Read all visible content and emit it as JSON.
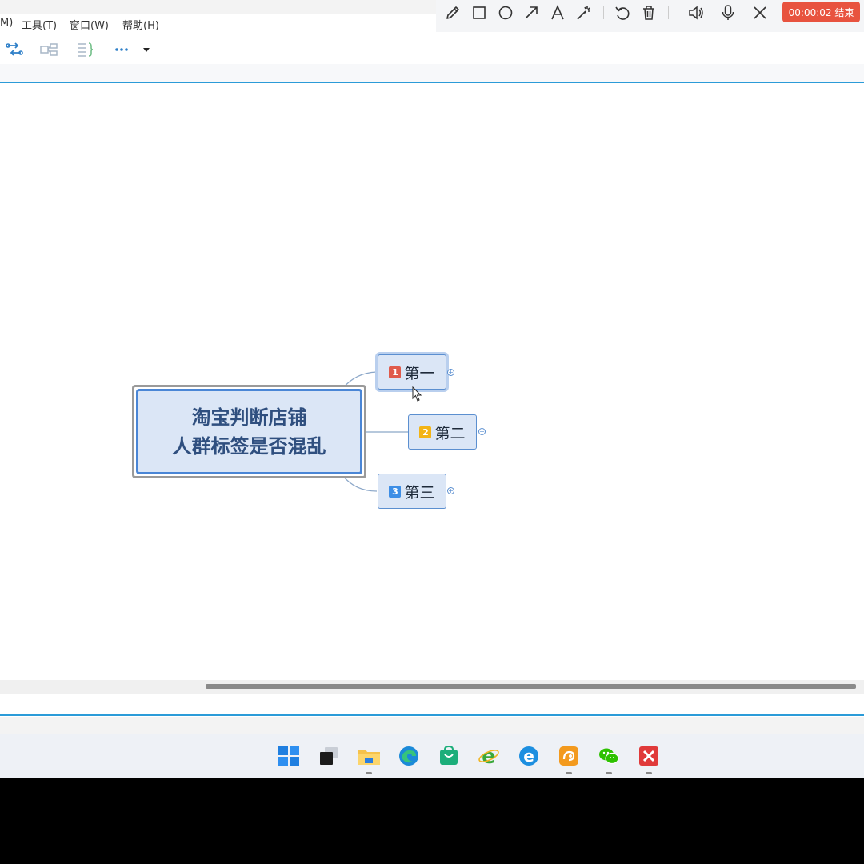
{
  "menu": {
    "items": [
      {
        "label": "M)"
      },
      {
        "label": "工具(T)"
      },
      {
        "label": "窗口(W)"
      },
      {
        "label": "帮助(H)"
      }
    ]
  },
  "recorder": {
    "tools": [
      "pencil-icon",
      "rectangle-icon",
      "ellipse-icon",
      "arrow-icon",
      "text-icon",
      "magic-wand-icon",
      "undo-icon",
      "delete-icon",
      "speaker-icon",
      "microphone-icon",
      "close-icon"
    ],
    "timer_label": "00:00:02 结束",
    "timer_color": "#e8533f"
  },
  "toolbar": {
    "icons": [
      "relationship-icon",
      "summary-icon",
      "boundary-icon",
      "more-icon",
      "dropdown-arrow-icon"
    ],
    "more_label": "···"
  },
  "mindmap": {
    "central": {
      "line1": "淘宝判断店铺",
      "line2": "人群标签是否混乱"
    },
    "topics": [
      {
        "badge": "1",
        "label": "第一",
        "badge_color": "#e05b4c",
        "selected": true
      },
      {
        "badge": "2",
        "label": "第二",
        "badge_color": "#f3b416",
        "selected": false
      },
      {
        "badge": "3",
        "label": "第三",
        "badge_color": "#3d8ee6",
        "selected": false
      }
    ],
    "accent": "#4a86d6",
    "fill": "#dbe6f6"
  },
  "taskbar": {
    "apps": [
      "windows-start-icon",
      "task-view-icon",
      "file-explorer-icon",
      "edge-icon",
      "store-icon",
      "ie-browser-icon",
      "edge-legacy-icon",
      "uc-browser-icon",
      "wechat-icon",
      "xmind-icon"
    ]
  }
}
